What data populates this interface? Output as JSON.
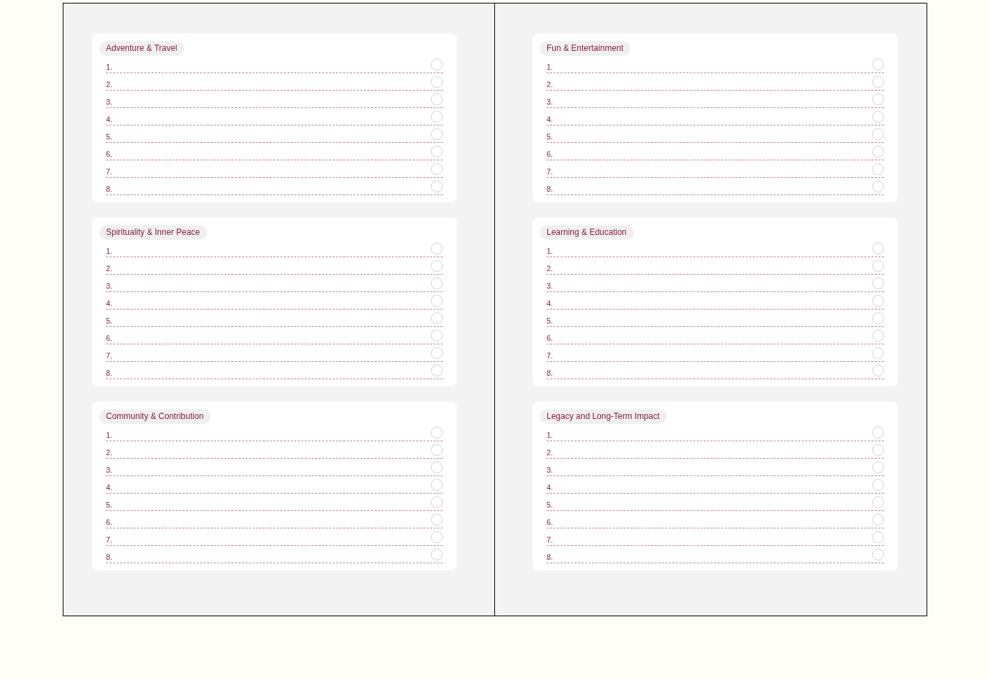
{
  "pages": [
    {
      "sections": [
        {
          "title": "Adventure & Travel",
          "items": [
            {
              "number": "1.",
              "checked": false
            },
            {
              "number": "2.",
              "checked": false
            },
            {
              "number": "3.",
              "checked": false
            },
            {
              "number": "4.",
              "checked": false
            },
            {
              "number": "5.",
              "checked": false
            },
            {
              "number": "6.",
              "checked": false
            },
            {
              "number": "7.",
              "checked": false
            },
            {
              "number": "8.",
              "checked": false
            }
          ]
        },
        {
          "title": "Spirituality & Inner Peace",
          "items": [
            {
              "number": "1.",
              "checked": false
            },
            {
              "number": "2.",
              "checked": false
            },
            {
              "number": "3.",
              "checked": false
            },
            {
              "number": "4.",
              "checked": false
            },
            {
              "number": "5.",
              "checked": false
            },
            {
              "number": "6.",
              "checked": false
            },
            {
              "number": "7.",
              "checked": false
            },
            {
              "number": "8.",
              "checked": false
            }
          ]
        },
        {
          "title": "Community & Contribution",
          "items": [
            {
              "number": "1.",
              "checked": false
            },
            {
              "number": "2.",
              "checked": false
            },
            {
              "number": "3.",
              "checked": false
            },
            {
              "number": "4.",
              "checked": false
            },
            {
              "number": "5.",
              "checked": false
            },
            {
              "number": "6.",
              "checked": false
            },
            {
              "number": "7.",
              "checked": false
            },
            {
              "number": "8.",
              "checked": false
            }
          ]
        }
      ]
    },
    {
      "sections": [
        {
          "title": "Fun & Entertainment",
          "items": [
            {
              "number": "1.",
              "checked": false
            },
            {
              "number": "2.",
              "checked": false
            },
            {
              "number": "3.",
              "checked": false
            },
            {
              "number": "4.",
              "checked": false
            },
            {
              "number": "5.",
              "checked": false
            },
            {
              "number": "6.",
              "checked": false
            },
            {
              "number": "7.",
              "checked": false
            },
            {
              "number": "8.",
              "checked": false
            }
          ]
        },
        {
          "title": "Learning & Education",
          "items": [
            {
              "number": "1.",
              "checked": false
            },
            {
              "number": "2.",
              "checked": false
            },
            {
              "number": "3.",
              "checked": false
            },
            {
              "number": "4.",
              "checked": false
            },
            {
              "number": "5.",
              "checked": false
            },
            {
              "number": "6.",
              "checked": false
            },
            {
              "number": "7.",
              "checked": false
            },
            {
              "number": "8.",
              "checked": false
            }
          ]
        },
        {
          "title": "Legacy and Long-Term Impact",
          "items": [
            {
              "number": "1.",
              "checked": false
            },
            {
              "number": "2.",
              "checked": false
            },
            {
              "number": "3.",
              "checked": false
            },
            {
              "number": "4.",
              "checked": false
            },
            {
              "number": "5.",
              "checked": false
            },
            {
              "number": "6.",
              "checked": false
            },
            {
              "number": "7.",
              "checked": false
            },
            {
              "number": "8.",
              "checked": false
            }
          ]
        }
      ]
    }
  ]
}
